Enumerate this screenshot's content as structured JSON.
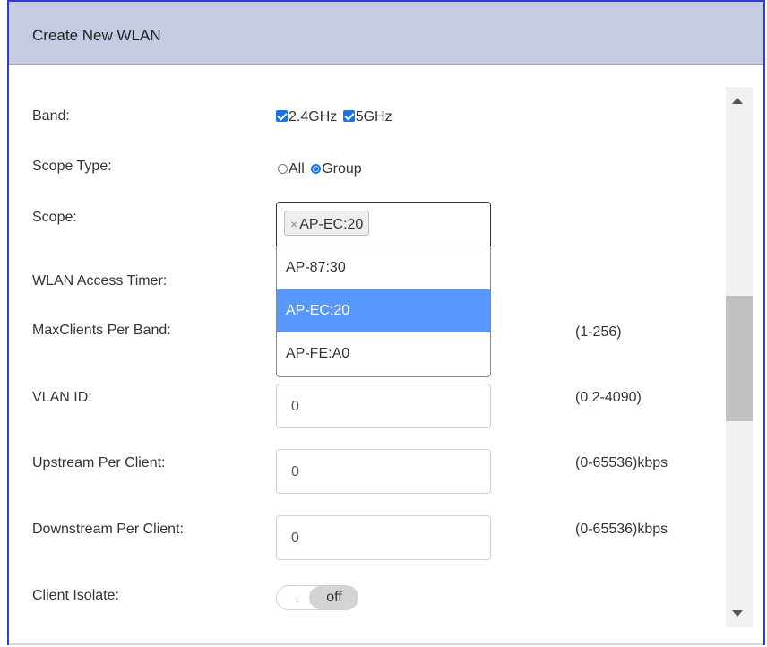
{
  "header": {
    "title": "Create New WLAN"
  },
  "band": {
    "label": "Band:",
    "options": [
      {
        "label": "2.4GHz",
        "checked": true
      },
      {
        "label": "5GHz",
        "checked": true
      }
    ]
  },
  "scope_type": {
    "label": "Scope Type:",
    "options": [
      {
        "label": "All",
        "selected": false
      },
      {
        "label": "Group",
        "selected": true
      }
    ]
  },
  "scope": {
    "label": "Scope:",
    "selected_tag": "AP-EC:20",
    "tag_remove": "×",
    "dropdown": [
      "AP-87:30",
      "AP-EC:20",
      "AP-FE:A0"
    ],
    "highlighted": "AP-EC:20"
  },
  "wlan_access_timer": {
    "label": "WLAN Access Timer:"
  },
  "max_clients": {
    "label": "MaxClients Per Band:",
    "range": "(1-256)"
  },
  "vlan_id": {
    "label": "VLAN ID:",
    "value": "0",
    "range": "(0,2-4090)"
  },
  "upstream": {
    "label": "Upstream Per Client:",
    "value": "0",
    "range": "(0-65536)kbps"
  },
  "downstream": {
    "label": "Downstream Per Client:",
    "value": "0",
    "range": "(0-65536)kbps"
  },
  "client_isolate": {
    "label": "Client Isolate:",
    "knob": ".",
    "state": "off"
  },
  "colors": {
    "accent": "#1a73e8",
    "highlight": "#5897fb",
    "header_bg": "#c5cbe3"
  }
}
